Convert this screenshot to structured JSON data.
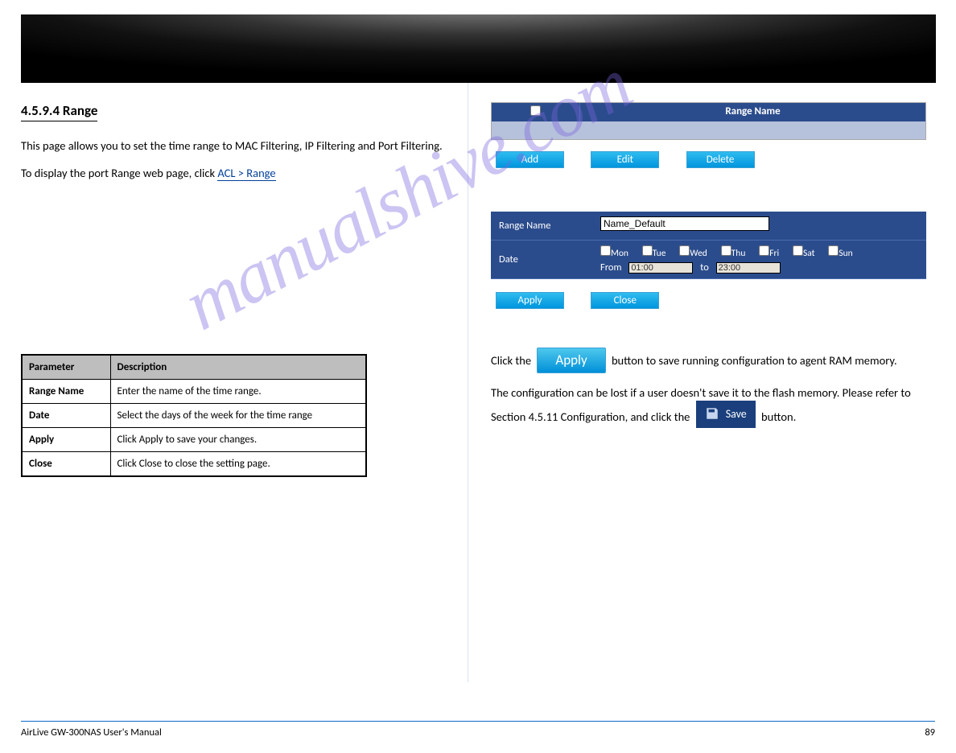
{
  "section_title": "4.5.9.4 Range",
  "intro": "This page allows you to set the time range to MAC Filtering, IP Filtering and Port Filtering.",
  "setup_lead": "To display the port Range web page, click",
  "setup_path": "ACL > Range",
  "range_list": {
    "header": "Range Name",
    "buttons": {
      "add": "Add",
      "edit": "Edit",
      "delete": "Delete"
    }
  },
  "form": {
    "range_name_label": "Range Name",
    "range_name_value": "Name_Default",
    "date_label": "Date",
    "days": [
      "Mon",
      "Tue",
      "Wed",
      "Thu",
      "Fri",
      "Sat",
      "Sun"
    ],
    "from_label": "From",
    "from_value": "01:00",
    "to_label": "to",
    "to_value": "23:00",
    "buttons": {
      "apply": "Apply",
      "close": "Close"
    }
  },
  "big_apply": "Apply",
  "save_button": "Save",
  "param_table": {
    "col1": "Parameter",
    "col2": "Description",
    "rows": [
      {
        "param": "Range Name",
        "desc": "Enter the name of the time range."
      },
      {
        "param": "Date",
        "desc": "Select the days of the week for the time range"
      },
      {
        "param": "Apply",
        "desc": "Click Apply to save your changes."
      },
      {
        "param": "Close",
        "desc": "Click Close to close the setting page."
      }
    ]
  },
  "apply_note": {
    "p1_prefix": "Click the ",
    "p1_suffix": " button to save running configuration to agent RAM memory.",
    "p2_prefix": "The configuration can be lost if a user doesn't save it to the flash memory. Please refer to Section 4.5.11 Configuration, and click the ",
    "p2_suffix": " button."
  },
  "watermark": "manualshive.com",
  "footer": {
    "left": "AirLive GW-300NAS User's Manual",
    "right": "89"
  }
}
